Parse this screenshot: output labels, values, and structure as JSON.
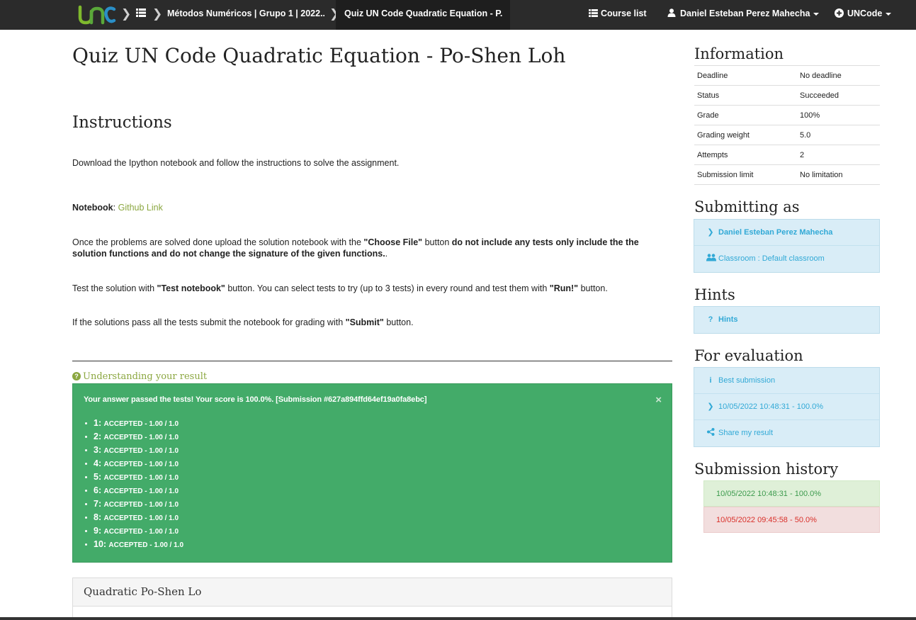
{
  "nav": {
    "course": "Métodos Numéricos | Grupo 1 | 2022...",
    "task": "Quiz UN Code Quadratic Equation - P...",
    "course_list": "Course list",
    "user": "Daniel Esteban Perez Mahecha",
    "brand_menu": "UNCode",
    "logo_colors": [
      "#7fb92d",
      "#2a8fc7"
    ]
  },
  "main": {
    "title": "Quiz UN Code Quadratic Equation - Po-Shen Loh",
    "instructions_heading": "Instructions",
    "p1": "Download the Ipython notebook and follow the instructions to solve the assignment.",
    "notebook_label": "Notebook",
    "notebook_colon": ":",
    "notebook_link": "Github Link",
    "p3_a": "Once the problems are solved done upload the solution notebook with the ",
    "p3_b": "\"Choose File\"",
    "p3_c": " button ",
    "p3_d": "do not include any tests only include the the solution functions and do not change the signature of the given functions.",
    "p3_e": ".",
    "p4_a": "Test the solution with ",
    "p4_b": "\"Test notebook\"",
    "p4_c": " button. You can select tests to try (up to 3 tests) in every round and test them with ",
    "p4_d": "\"Run!\"",
    "p4_e": " button.",
    "p5_a": "If the solutions pass all the tests submit the notebook for grading with ",
    "p5_b": "\"Submit\"",
    "p5_c": " button.",
    "understanding": "Understanding your result",
    "result_header": "Your answer passed the tests! Your score is 100.0%. [Submission #627a894ffd64ef19a0fa8ebc]",
    "close": "×",
    "results": [
      {
        "num": "1:",
        "text": "ACCEPTED - 1.00 / 1.0"
      },
      {
        "num": "2:",
        "text": "ACCEPTED - 1.00 / 1.0"
      },
      {
        "num": "3:",
        "text": "ACCEPTED - 1.00 / 1.0"
      },
      {
        "num": "4:",
        "text": "ACCEPTED - 1.00 / 1.0"
      },
      {
        "num": "5:",
        "text": "ACCEPTED - 1.00 / 1.0"
      },
      {
        "num": "6:",
        "text": "ACCEPTED - 1.00 / 1.0"
      },
      {
        "num": "7:",
        "text": "ACCEPTED - 1.00 / 1.0"
      },
      {
        "num": "8:",
        "text": "ACCEPTED - 1.00 / 1.0"
      },
      {
        "num": "9:",
        "text": "ACCEPTED - 1.00 / 1.0"
      },
      {
        "num": "10:",
        "text": "ACCEPTED - 1.00 / 1.0"
      }
    ],
    "problem_title": "Quadratic Po-Shen Lo",
    "success_color": "#43ab69"
  },
  "sidebar": {
    "information_title": "Information",
    "info": [
      {
        "key": "Deadline",
        "value": "No deadline"
      },
      {
        "key": "Status",
        "value": "Succeeded"
      },
      {
        "key": "Grade",
        "value": "100%"
      },
      {
        "key": "Grading weight",
        "value": "5.0"
      },
      {
        "key": "Attempts",
        "value": "2"
      },
      {
        "key": "Submission limit",
        "value": "No limitation"
      }
    ],
    "submitting_title": "Submitting as",
    "submitter": "Daniel Esteban Perez Mahecha",
    "classroom": "Classroom : Default classroom",
    "hints_title": "Hints",
    "hints": "Hints",
    "evaluation_title": "For evaluation",
    "best_submission": "Best submission",
    "eval_submission": "10/05/2022 10:48:31 - 100.0%",
    "share": "Share my result",
    "history_title": "Submission history",
    "history": [
      {
        "text": "10/05/2022 10:48:31 - 100.0%",
        "status": "success"
      },
      {
        "text": "10/05/2022 09:45:58 - 50.0%",
        "status": "failed"
      }
    ]
  }
}
